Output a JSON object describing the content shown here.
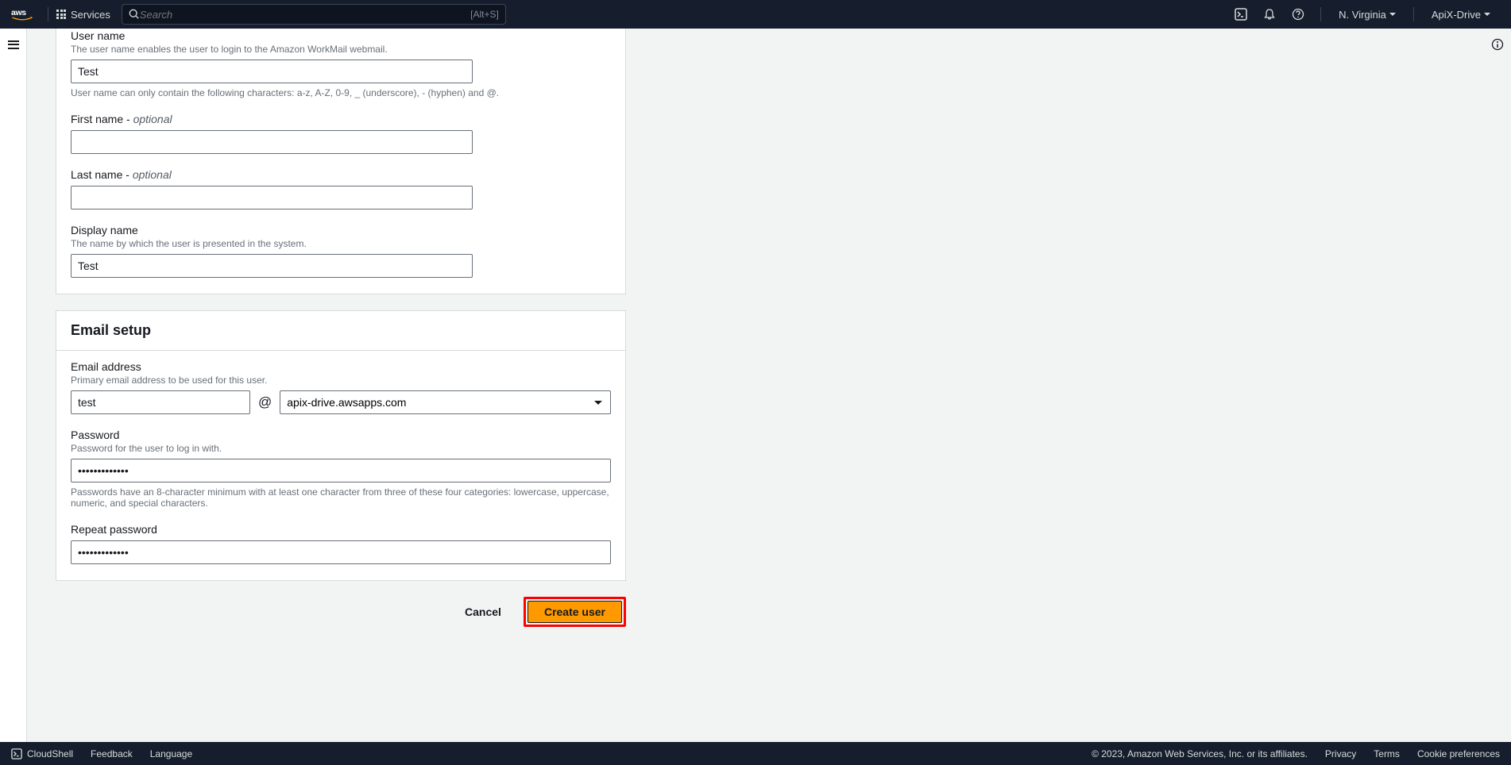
{
  "nav": {
    "logo": "aws",
    "services": "Services",
    "search_placeholder": "Search",
    "search_shortcut": "[Alt+S]",
    "region": "N. Virginia",
    "account": "ApiX-Drive"
  },
  "form": {
    "user_name": {
      "label": "User name",
      "desc": "The user name enables the user to login to the Amazon WorkMail webmail.",
      "value": "Test",
      "hint": "User name can only contain the following characters: a-z, A-Z, 0-9, _ (underscore), - (hyphen) and @."
    },
    "first_name": {
      "label": "First name - ",
      "optional": "optional",
      "value": ""
    },
    "last_name": {
      "label": "Last name - ",
      "optional": "optional",
      "value": ""
    },
    "display_name": {
      "label": "Display name",
      "desc": "The name by which the user is presented in the system.",
      "value": "Test"
    }
  },
  "email_setup": {
    "header": "Email setup",
    "email": {
      "label": "Email address",
      "desc": "Primary email address to be used for this user.",
      "local": "test",
      "at": "@",
      "domain": "apix-drive.awsapps.com"
    },
    "password": {
      "label": "Password",
      "desc": "Password for the user to log in with.",
      "value": "•••••••••••••",
      "hint": "Passwords have an 8-character minimum with at least one character from three of these four categories: lowercase, uppercase, numeric, and special characters."
    },
    "repeat_password": {
      "label": "Repeat password",
      "value": "•••••••••••••"
    }
  },
  "actions": {
    "cancel": "Cancel",
    "create": "Create user"
  },
  "footer": {
    "cloudshell": "CloudShell",
    "feedback": "Feedback",
    "language": "Language",
    "copyright": "© 2023, Amazon Web Services, Inc. or its affiliates.",
    "privacy": "Privacy",
    "terms": "Terms",
    "cookie": "Cookie preferences"
  }
}
